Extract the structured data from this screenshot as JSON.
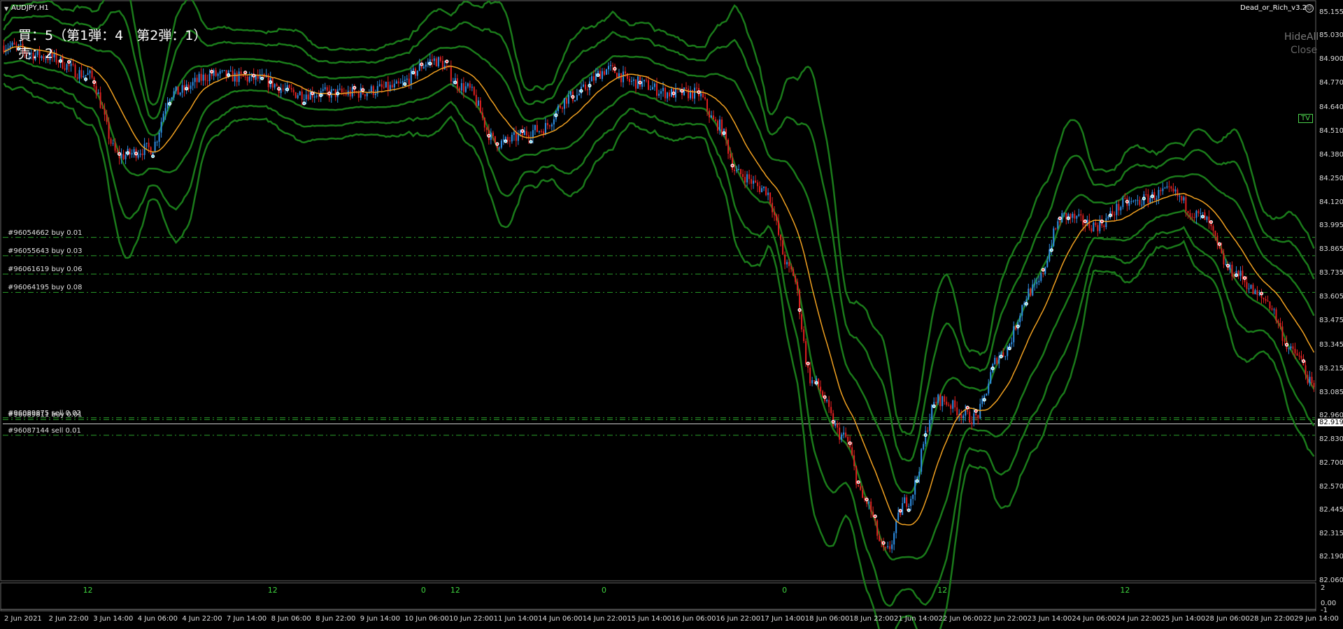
{
  "window": {
    "symbol_title": "AUDJPY,H1",
    "ea_name": "Dead_or_Rich_v3.2",
    "ea_icon": "smiley-icon"
  },
  "stats": {
    "buy_line": "買：5（第1弾：4　第2弾：1）",
    "sell_line": "売：2"
  },
  "controls": {
    "hide_all": "HideAll",
    "close": "Close",
    "tv_badge": "TV"
  },
  "orders": [
    {
      "label": "#96054662 buy 0.01",
      "price": 83.935,
      "type": "buy"
    },
    {
      "label": "#96055643 buy 0.03",
      "price": 83.835,
      "type": "buy"
    },
    {
      "label": "#96061619 buy 0.06",
      "price": 83.735,
      "type": "buy"
    },
    {
      "label": "#96064195 buy 0.08",
      "price": 83.635,
      "type": "buy"
    },
    {
      "label": "#96089875 sell 0.02",
      "price": 82.952,
      "type": "sell"
    },
    {
      "label": "#96089811 buy 0.01",
      "price": 82.942,
      "type": "buy"
    },
    {
      "label": "#96087144 sell 0.01",
      "price": 82.857,
      "type": "sell"
    }
  ],
  "price_scale": [
    "85.155",
    "85.030",
    "84.900",
    "84.770",
    "84.640",
    "84.510",
    "84.380",
    "84.250",
    "84.120",
    "83.995",
    "83.865",
    "83.735",
    "83.605",
    "83.475",
    "83.345",
    "83.215",
    "83.085",
    "82.960",
    "82.830",
    "82.700",
    "82.570",
    "82.445",
    "82.315",
    "82.190",
    "82.060"
  ],
  "current_price": "82.919",
  "subwindow_scale": [
    "2",
    "0.00",
    "-1"
  ],
  "hour_markers": [
    {
      "text": "12",
      "candle": 39
    },
    {
      "text": "12",
      "candle": 127
    },
    {
      "text": "0",
      "candle": 200
    },
    {
      "text": "12",
      "candle": 214
    },
    {
      "text": "0",
      "candle": 286
    },
    {
      "text": "0",
      "candle": 372
    },
    {
      "text": "12",
      "candle": 446
    },
    {
      "text": "12",
      "candle": 533
    }
  ],
  "date_labels": [
    "2 Jun 2021",
    "2 Jun 22:00",
    "3 Jun 14:00",
    "4 Jun 06:00",
    "4 Jun 22:00",
    "7 Jun 14:00",
    "8 Jun 06:00",
    "8 Jun 22:00",
    "9 Jun 14:00",
    "10 Jun 06:00",
    "10 Jun 22:00",
    "11 Jun 14:00",
    "14 Jun 06:00",
    "14 Jun 22:00",
    "15 Jun 14:00",
    "16 Jun 06:00",
    "16 Jun 22:00",
    "17 Jun 14:00",
    "18 Jun 06:00",
    "18 Jun 22:00",
    "21 Jun 14:00",
    "22 Jun 06:00",
    "22 Jun 22:00",
    "23 Jun 14:00",
    "24 Jun 06:00",
    "24 Jun 22:00",
    "25 Jun 14:00",
    "28 Jun 06:00",
    "28 Jun 22:00",
    "29 Jun 14:00"
  ],
  "colors": {
    "bull": "#2e8fe6",
    "bear": "#e02020",
    "bands": "#1a7a1a",
    "ma": "#f0a020",
    "grid_dash": "#2aa02a",
    "arrow_buy": "#4fd0f0",
    "arrow_sell": "#ff4040"
  },
  "chart_data": {
    "type": "candlestick",
    "symbol": "AUDJPY",
    "timeframe": "H1",
    "ylim": [
      82.06,
      85.16
    ],
    "path": [
      [
        0,
        84.98
      ],
      [
        20,
        84.92
      ],
      [
        40,
        84.82
      ],
      [
        55,
        84.38
      ],
      [
        70,
        84.42
      ],
      [
        80,
        84.72
      ],
      [
        100,
        84.82
      ],
      [
        120,
        84.8
      ],
      [
        140,
        84.72
      ],
      [
        165,
        84.72
      ],
      [
        185,
        84.75
      ],
      [
        205,
        84.9
      ],
      [
        220,
        84.75
      ],
      [
        235,
        84.45
      ],
      [
        255,
        84.52
      ],
      [
        270,
        84.7
      ],
      [
        288,
        84.85
      ],
      [
        300,
        84.78
      ],
      [
        318,
        84.72
      ],
      [
        330,
        84.72
      ],
      [
        340,
        84.55
      ],
      [
        350,
        84.28
      ],
      [
        362,
        84.2
      ],
      [
        375,
        83.75
      ],
      [
        385,
        83.15
      ],
      [
        400,
        82.85
      ],
      [
        410,
        82.5
      ],
      [
        420,
        82.22
      ],
      [
        430,
        82.5
      ],
      [
        445,
        83.05
      ],
      [
        462,
        82.95
      ],
      [
        475,
        83.3
      ],
      [
        490,
        83.65
      ],
      [
        505,
        84.05
      ],
      [
        520,
        84.0
      ],
      [
        535,
        84.12
      ],
      [
        555,
        84.18
      ],
      [
        570,
        84.05
      ],
      [
        585,
        83.75
      ],
      [
        600,
        83.6
      ],
      [
        615,
        83.3
      ],
      [
        625,
        83.1
      ]
    ],
    "candle_count": 625,
    "candle_seed": 7
  }
}
